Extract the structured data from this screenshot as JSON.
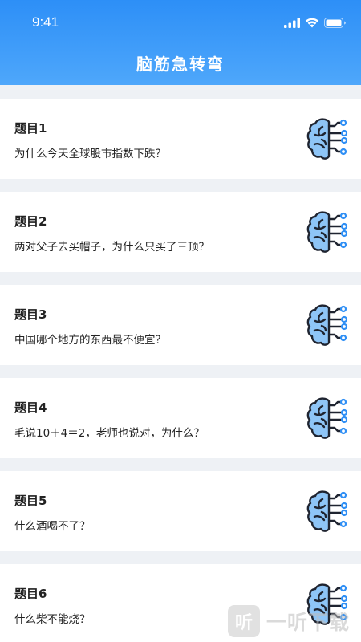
{
  "status_bar": {
    "time": "9:41"
  },
  "header": {
    "title": "脑筋急转弯"
  },
  "items": [
    {
      "title": "题目1",
      "question": "为什么今天全球股市指数下跌？"
    },
    {
      "title": "题目2",
      "question": "两对父子去买帽子，为什么只买了三顶？"
    },
    {
      "title": "题目3",
      "question": "中国哪个地方的东西最不便宜？"
    },
    {
      "title": "题目4",
      "question": "毛说10＋4＝2，老师也说对，为什么？"
    },
    {
      "title": "题目5",
      "question": "什么酒喝不了？"
    },
    {
      "title": "题目6",
      "question": "什么柴不能烧？"
    }
  ],
  "icons": {
    "item_icon": "brain-circuit-icon"
  },
  "colors": {
    "accent": "#2d8ff7",
    "brain_fill": "#8ec5f7",
    "node": "#2f8ff5"
  },
  "watermark": {
    "badge": "听",
    "text": "一听下载"
  }
}
